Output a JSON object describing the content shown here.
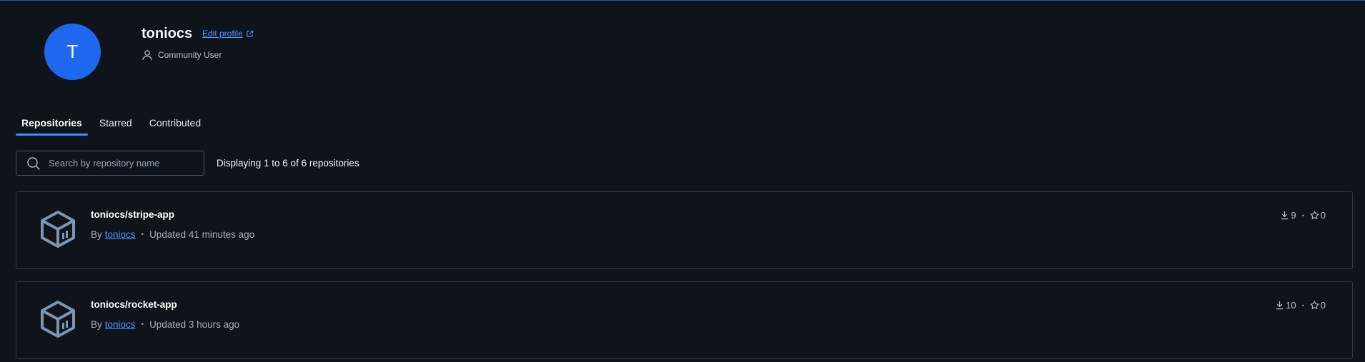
{
  "profile": {
    "avatar_initial": "T",
    "username": "toniocs",
    "edit_profile_label": "Edit profile",
    "role": "Community User"
  },
  "tabs": [
    {
      "label": "Repositories",
      "active": true
    },
    {
      "label": "Starred",
      "active": false
    },
    {
      "label": "Contributed",
      "active": false
    }
  ],
  "search": {
    "placeholder": "Search by repository name",
    "value": ""
  },
  "results_text": "Displaying 1 to 6 of 6 repositories",
  "repositories": [
    {
      "name": "toniocs/stripe-app",
      "by_label": "By",
      "owner": "toniocs",
      "updated": "Updated 41 minutes ago",
      "downloads": "9",
      "stars": "0"
    },
    {
      "name": "toniocs/rocket-app",
      "by_label": "By",
      "owner": "toniocs",
      "updated": "Updated 3 hours ago",
      "downloads": "10",
      "stars": "0"
    }
  ],
  "colors": {
    "background": "#0f131a",
    "accent": "#1e67ef",
    "link": "#4d9bff",
    "tab_indicator": "#3f8cff",
    "card_border": "#343b46",
    "repo_icon": "#7b96b2"
  },
  "icons": {
    "avatar": "avatar",
    "edit": "external-link-icon",
    "role": "user-icon",
    "search": "search-icon",
    "repo": "cube-repository-icon",
    "downloads": "download-icon",
    "stars": "star-icon"
  }
}
